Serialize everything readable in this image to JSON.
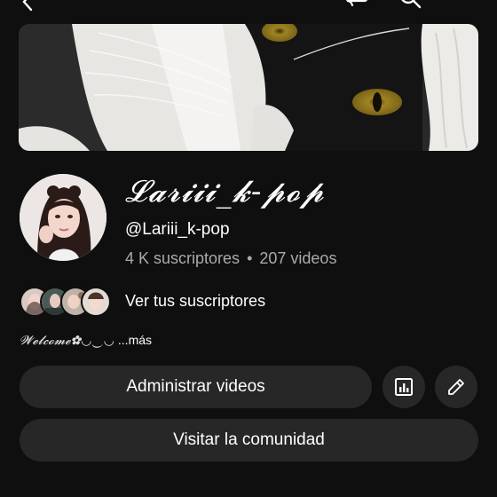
{
  "topbar": {
    "icons": [
      "back-icon",
      "cast-icon",
      "search-icon",
      "more-vert-icon"
    ]
  },
  "channel": {
    "name": "𝓛𝓪𝓻𝓲𝓲𝓲_𝓴-𝓹𝓸𝓹",
    "handle": "@Lariii_k-pop",
    "subscribers": "4 K suscriptores",
    "separator": "•",
    "videos": "207 videos"
  },
  "subscribers_row": {
    "label": "Ver tus suscriptores"
  },
  "description": {
    "text": "𝓦𝓮𝓵𝓬𝓸𝓶𝓮✿◡‿◡",
    "more": "...más"
  },
  "buttons": {
    "manage": "Administrar videos",
    "analytics_icon": "analytics-icon",
    "edit_icon": "edit-icon",
    "community": "Visitar la comunidad"
  },
  "colors": {
    "background": "#0f0f0f",
    "button": "#272727",
    "secondary_text": "#aaaaaa"
  }
}
